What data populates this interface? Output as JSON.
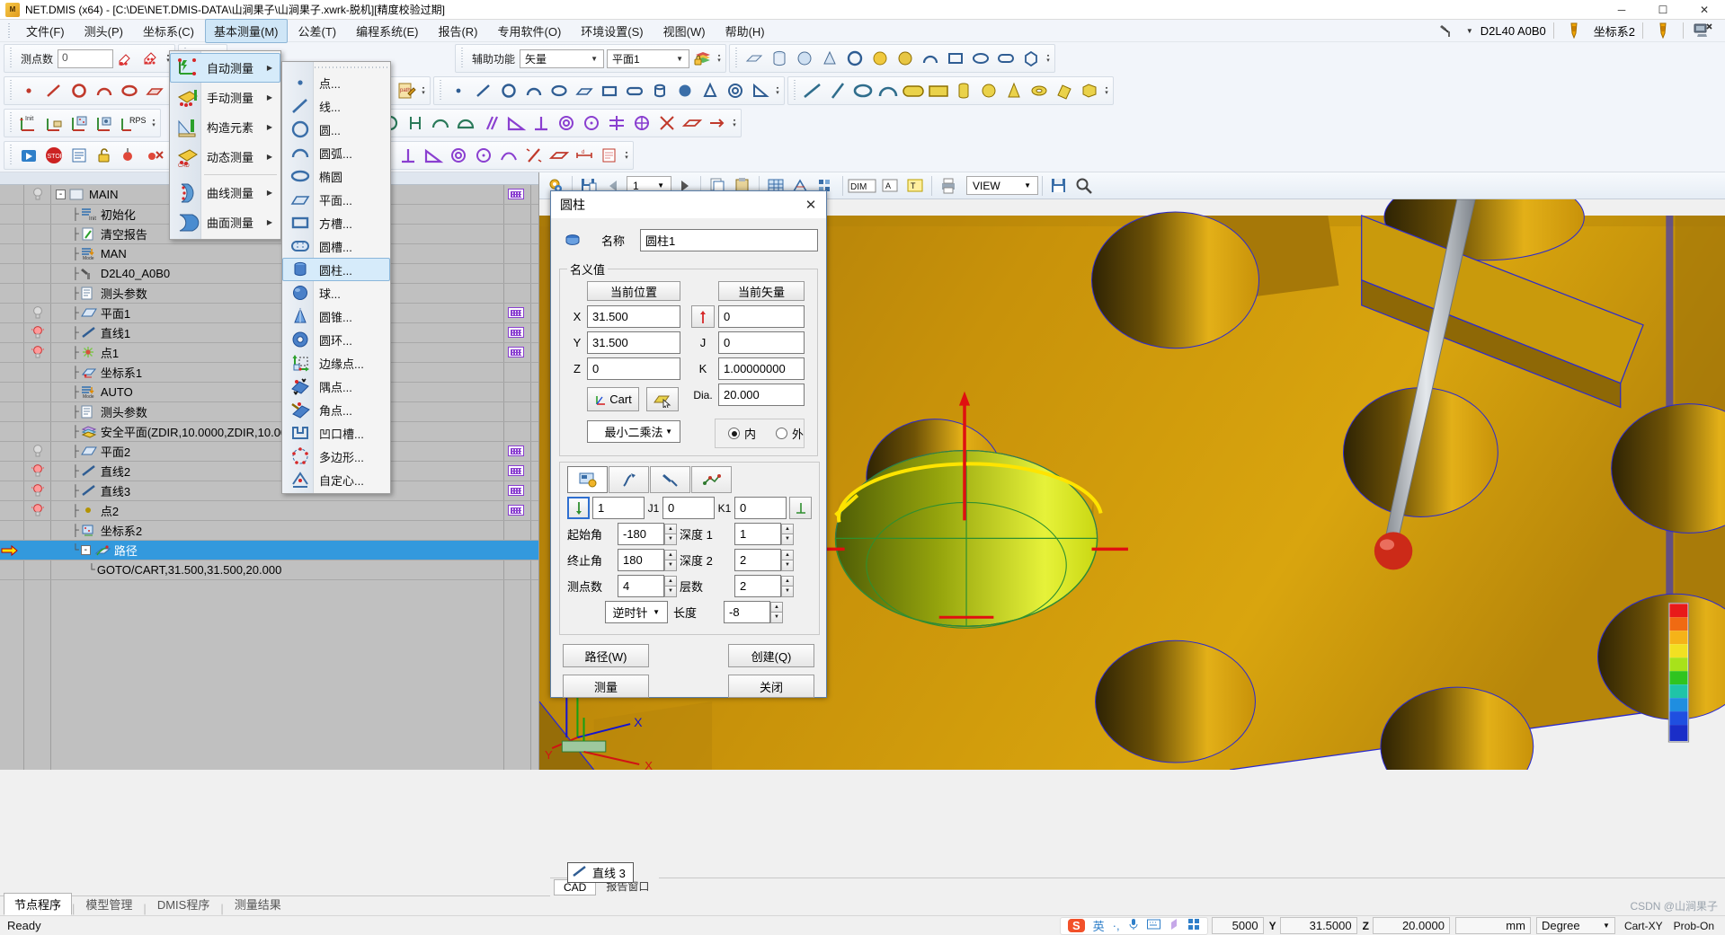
{
  "window": {
    "title": "NET.DMIS (x64) - [C:\\DE\\NET.DMIS-DATA\\山涧果子\\山涧果子.xwrk-脱机][精度校验过期]",
    "minimize": "─",
    "maximize": "☐",
    "close": "✕"
  },
  "menubar": [
    {
      "label": "文件(F)",
      "active": false
    },
    {
      "label": "测头(P)",
      "active": false
    },
    {
      "label": "坐标系(C)",
      "active": false
    },
    {
      "label": "基本测量(M)",
      "active": true
    },
    {
      "label": "公差(T)",
      "active": false
    },
    {
      "label": "编程系统(E)",
      "active": false
    },
    {
      "label": "报告(R)",
      "active": false
    },
    {
      "label": "专用软件(O)",
      "active": false
    },
    {
      "label": "环境设置(S)",
      "active": false
    },
    {
      "label": "视图(W)",
      "active": false
    },
    {
      "label": "帮助(H)",
      "active": false
    }
  ],
  "toolbar": {
    "point_count_label": "测点数",
    "point_count_value": "0",
    "aux_label": "辅助功能",
    "vector_combo": "矢量",
    "plane_combo": "平面1",
    "probe_label": "D2L40  A0B0",
    "csys_label": "坐标系2"
  },
  "menu_popup_main": {
    "items": [
      {
        "label": "自动测量",
        "icon": "auto-measure-icon",
        "highlighted": true,
        "submenu": true
      },
      {
        "label": "手动测量",
        "icon": "manual-measure-icon",
        "highlighted": false,
        "submenu": true
      },
      {
        "label": "构造元素",
        "icon": "construct-element-icon",
        "highlighted": false,
        "submenu": true
      },
      {
        "label": "动态测量",
        "icon": "dynamic-measure-icon",
        "highlighted": false,
        "submenu": true
      },
      {
        "label": "曲线测量",
        "icon": "curve-measure-icon",
        "highlighted": false,
        "submenu": true
      },
      {
        "label": "曲面测量",
        "icon": "surface-measure-icon",
        "highlighted": false,
        "submenu": true
      }
    ]
  },
  "menu_popup_sub": {
    "items": [
      {
        "label": "点...",
        "icon": "point-icon",
        "highlighted": false
      },
      {
        "label": "线...",
        "icon": "line-icon",
        "highlighted": false
      },
      {
        "label": "圆...",
        "icon": "circle-icon",
        "highlighted": false
      },
      {
        "label": "圆弧...",
        "icon": "arc-icon",
        "highlighted": false
      },
      {
        "label": "椭圆",
        "icon": "ellipse-icon",
        "highlighted": false
      },
      {
        "label": "平面...",
        "icon": "plane-icon",
        "highlighted": false
      },
      {
        "label": "方槽...",
        "icon": "square-slot-icon",
        "highlighted": false
      },
      {
        "label": "圆槽...",
        "icon": "round-slot-icon",
        "highlighted": false
      },
      {
        "label": "圆柱...",
        "icon": "cylinder-icon",
        "highlighted": true
      },
      {
        "label": "球...",
        "icon": "sphere-icon",
        "highlighted": false
      },
      {
        "label": "圆锥...",
        "icon": "cone-icon",
        "highlighted": false
      },
      {
        "label": "圆环...",
        "icon": "torus-icon",
        "highlighted": false
      },
      {
        "label": "边缘点...",
        "icon": "edge-point-icon",
        "highlighted": false
      },
      {
        "label": "隅点...",
        "icon": "corner-point-icon",
        "highlighted": false
      },
      {
        "label": "角点...",
        "icon": "angle-point-icon",
        "highlighted": false
      },
      {
        "label": "凹口槽...",
        "icon": "notch-slot-icon",
        "highlighted": false
      },
      {
        "label": "多边形...",
        "icon": "polygon-icon",
        "highlighted": false
      },
      {
        "label": "自定心...",
        "icon": "self-center-icon",
        "highlighted": false
      }
    ]
  },
  "tree": {
    "rows": [
      {
        "label": "MAIN",
        "icon": "folder-main-icon",
        "indent": 0,
        "expander": "-",
        "bulb": "off",
        "selected": false,
        "guide": ""
      },
      {
        "label": "初始化",
        "icon": "init-icon",
        "indent": 1,
        "expander": "",
        "bulb": "",
        "selected": false,
        "guide": "├"
      },
      {
        "label": "清空报告",
        "icon": "clear-report-icon",
        "indent": 1,
        "expander": "",
        "bulb": "",
        "selected": false,
        "guide": "├"
      },
      {
        "label": "MAN",
        "icon": "mode-icon",
        "indent": 1,
        "expander": "",
        "bulb": "",
        "selected": false,
        "guide": "├"
      },
      {
        "label": "D2L40_A0B0",
        "icon": "probe-icon",
        "indent": 1,
        "expander": "",
        "bulb": "",
        "selected": false,
        "guide": "├"
      },
      {
        "label": "测头参数",
        "icon": "probe-param-icon",
        "indent": 1,
        "expander": "",
        "bulb": "",
        "selected": false,
        "guide": "├"
      },
      {
        "label": "平面1",
        "icon": "plane-icon",
        "indent": 1,
        "expander": "",
        "bulb": "off",
        "selected": false,
        "guide": "├"
      },
      {
        "label": "直线1",
        "icon": "line-icon",
        "indent": 1,
        "expander": "",
        "bulb": "on",
        "selected": false,
        "guide": "├"
      },
      {
        "label": "点1",
        "icon": "point-star-icon",
        "indent": 1,
        "expander": "",
        "bulb": "on",
        "selected": false,
        "guide": "├"
      },
      {
        "label": "坐标系1",
        "icon": "csys-icon",
        "indent": 1,
        "expander": "",
        "bulb": "",
        "selected": false,
        "guide": "├"
      },
      {
        "label": "AUTO",
        "icon": "mode-icon",
        "indent": 1,
        "expander": "",
        "bulb": "",
        "selected": false,
        "guide": "├"
      },
      {
        "label": "测头参数",
        "icon": "probe-param-icon",
        "indent": 1,
        "expander": "",
        "bulb": "",
        "selected": false,
        "guide": "├"
      },
      {
        "label": "安全平面(ZDIR,10.0000,ZDIR,10.0000,O[",
        "icon": "safeplane-icon",
        "indent": 1,
        "expander": "",
        "bulb": "",
        "selected": false,
        "guide": "├"
      },
      {
        "label": "平面2",
        "icon": "plane-icon",
        "indent": 1,
        "expander": "",
        "bulb": "off",
        "selected": false,
        "guide": "├"
      },
      {
        "label": "直线2",
        "icon": "line-icon",
        "indent": 1,
        "expander": "",
        "bulb": "on",
        "selected": false,
        "guide": "├"
      },
      {
        "label": "直线3",
        "icon": "line-icon",
        "indent": 1,
        "expander": "",
        "bulb": "on",
        "selected": false,
        "guide": "├"
      },
      {
        "label": "点2",
        "icon": "point-dot-icon",
        "indent": 1,
        "expander": "",
        "bulb": "on",
        "selected": false,
        "guide": "├"
      },
      {
        "label": "坐标系2",
        "icon": "csys2-icon",
        "indent": 1,
        "expander": "",
        "bulb": "",
        "selected": false,
        "guide": "├"
      },
      {
        "label": "路径",
        "icon": "path-icon",
        "indent": 1,
        "expander": "-",
        "bulb": "",
        "selected": true,
        "guide": "└"
      },
      {
        "label": "GOTO/CART,31.500,31.500,20.000",
        "icon": "",
        "indent": 2,
        "expander": "",
        "bulb": "",
        "selected": false,
        "guide": "└"
      }
    ]
  },
  "viewtoolbar": {
    "page_value": "1",
    "view_combo": "VIEW"
  },
  "dialog": {
    "title": "圆柱",
    "close": "✕",
    "name_label": "名称",
    "name_value": "圆柱1",
    "nominal_legend": "名义值",
    "current_pos_btn": "当前位置",
    "current_vec_btn": "当前矢量",
    "pos": [
      {
        "label": "X",
        "value": "31.500"
      },
      {
        "label": "Y",
        "value": "31.500"
      },
      {
        "label": "Z",
        "value": "0"
      }
    ],
    "vec": [
      {
        "label": "I",
        "value": "0"
      },
      {
        "label": "J",
        "value": "0"
      },
      {
        "label": "K",
        "value": "1.00000000"
      },
      {
        "label": "Dia.",
        "value": "20.000"
      }
    ],
    "cart_btn": "Cart",
    "fit_method": "最小二乘法",
    "inner_label": "内",
    "outer_label": "外",
    "inner_selected": true,
    "vec2": [
      {
        "label": "I1",
        "value": "1"
      },
      {
        "label": "J1",
        "value": "0"
      },
      {
        "label": "K1",
        "value": "0"
      }
    ],
    "params": [
      {
        "label": "起始角",
        "value": "-180",
        "label2": "深度 1",
        "value2": "1"
      },
      {
        "label": "终止角",
        "value": "180",
        "label2": "深度 2",
        "value2": "2"
      },
      {
        "label": "测点数",
        "value": "4",
        "label2": "层数",
        "value2": "2"
      }
    ],
    "direction": "逆时针",
    "length_label": "长度",
    "length_value": "-8",
    "buttons": {
      "path": "路径(W)",
      "create": "创建(Q)",
      "measure": "测量",
      "close": "关闭"
    }
  },
  "viewtabs": [
    {
      "label": "CAD",
      "active": true
    },
    {
      "label": "报告窗口",
      "active": false
    }
  ],
  "bottomtabs": [
    {
      "label": "节点程序",
      "active": true
    },
    {
      "label": "模型管理",
      "active": false
    },
    {
      "label": "DMIS程序",
      "active": false
    },
    {
      "label": "测量结果",
      "active": false
    }
  ],
  "statusbar": {
    "ready": "Ready",
    "ime": [
      "S",
      "英",
      "·,",
      "mic-icon",
      "keyboard-icon",
      "palette-icon",
      "apps-icon"
    ],
    "speed": "5000",
    "axes": [
      {
        "label": "Y",
        "value": "31.5000"
      },
      {
        "label": "Z",
        "value": "20.0000"
      }
    ],
    "unit": "mm",
    "angle_unit": "Degree",
    "cart_mode": "Cart-XY",
    "probe_status": "Prob-On"
  },
  "cad_label": "直线 3",
  "watermark": "CSDN @山涧果子",
  "colors": {
    "accent": "#3399dd",
    "part": "#c8920a",
    "highlight": "#d6ebfa",
    "selected_face": "#d4e02a"
  }
}
